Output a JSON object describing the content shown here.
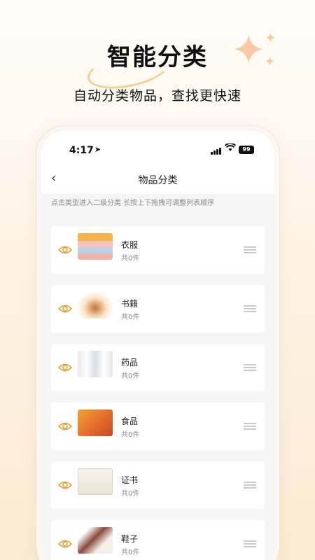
{
  "hero": {
    "title": "智能分类",
    "subtitle": "自动分类物品，查找更快速"
  },
  "status_bar": {
    "time": "4:17",
    "battery": "99",
    "icons": [
      "location-arrow-icon",
      "cellular-signal-icon",
      "wifi-icon",
      "battery-icon"
    ]
  },
  "nav": {
    "title": "物品分类",
    "back_icon": "chevron-left-icon"
  },
  "hint": "点击类型进入二级分类 长按上下拖拽可调整列表顺序",
  "categories": [
    {
      "name": "衣服",
      "count": "共0件",
      "thumb": "folded-clothes"
    },
    {
      "name": "书籍",
      "count": "共0件",
      "thumb": "open-book"
    },
    {
      "name": "药品",
      "count": "共0件",
      "thumb": "medicine-bottles"
    },
    {
      "name": "食品",
      "count": "共0件",
      "thumb": "food-box"
    },
    {
      "name": "证书",
      "count": "共0件",
      "thumb": "certificate"
    },
    {
      "name": "鞋子",
      "count": "共0件",
      "thumb": "sneakers"
    }
  ],
  "colors": {
    "accent": "#e0a43a",
    "background": "#fdf3e4"
  }
}
